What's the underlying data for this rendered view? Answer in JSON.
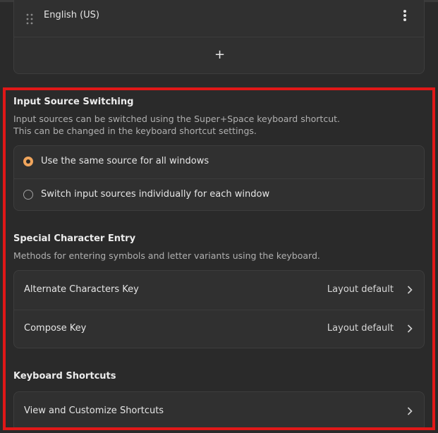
{
  "languages": {
    "items": [
      {
        "label": "English (US)"
      }
    ],
    "add_label": "+"
  },
  "input_switching": {
    "title": "Input Source Switching",
    "desc_line1": "Input sources can be switched using the Super+Space keyboard shortcut.",
    "desc_line2": "This can be changed in the keyboard shortcut settings.",
    "options": [
      {
        "label": "Use the same source for all windows",
        "selected": true
      },
      {
        "label": "Switch input sources individually for each window",
        "selected": false
      }
    ]
  },
  "special_chars": {
    "title": "Special Character Entry",
    "desc": "Methods for entering symbols and letter variants using the keyboard.",
    "rows": [
      {
        "label": "Alternate Characters Key",
        "value": "Layout default"
      },
      {
        "label": "Compose Key",
        "value": "Layout default"
      }
    ]
  },
  "shortcuts": {
    "title": "Keyboard Shortcuts",
    "row_label": "View and Customize Shortcuts"
  },
  "colors": {
    "accent": "#f0a55c",
    "highlight": "#e01818",
    "background": "#2a2a2a",
    "card": "#303030"
  }
}
